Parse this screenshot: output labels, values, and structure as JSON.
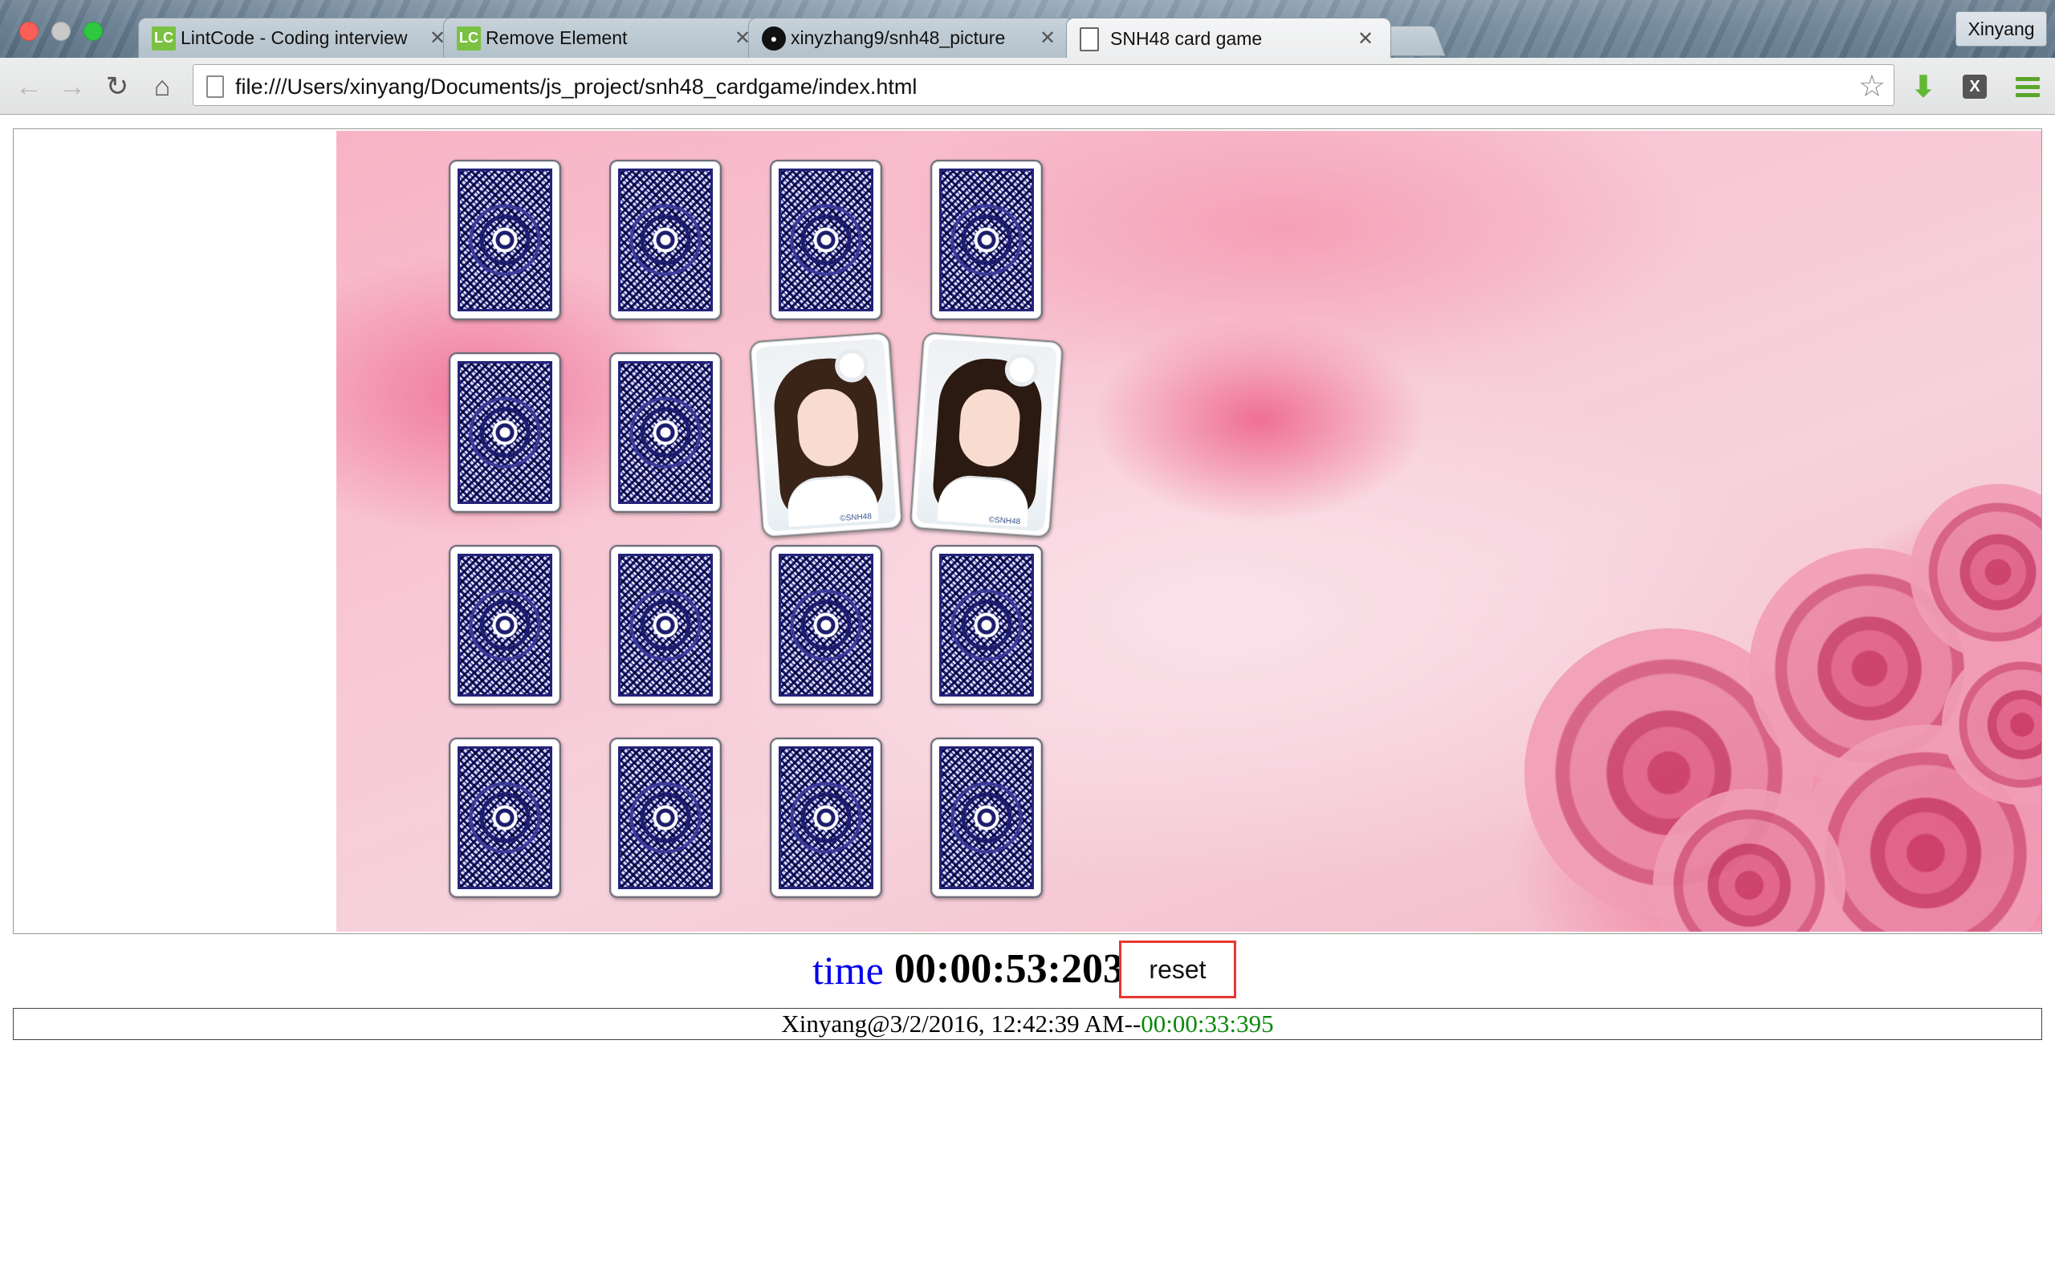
{
  "window": {
    "tabs": [
      {
        "label": "LintCode - Coding interview",
        "favicon": "LC",
        "icon": "lintcode-favicon"
      },
      {
        "label": "Remove Element",
        "favicon": "LC",
        "icon": "lintcode-favicon"
      },
      {
        "label": "xinyzhang9/snh48_picture",
        "favicon": "",
        "icon": "github-favicon"
      },
      {
        "label": "SNH48 card game",
        "favicon": "",
        "icon": "document-favicon"
      }
    ],
    "active_tab": 3,
    "profile": "Xinyang",
    "url": "file:///Users/xinyang/Documents/js_project/snh48_cardgame/index.html"
  },
  "game": {
    "cards": [
      {
        "row": 0,
        "col": 0,
        "state": "face-down"
      },
      {
        "row": 0,
        "col": 1,
        "state": "face-down"
      },
      {
        "row": 0,
        "col": 2,
        "state": "face-down"
      },
      {
        "row": 0,
        "col": 3,
        "state": "face-down"
      },
      {
        "row": 1,
        "col": 0,
        "state": "face-down"
      },
      {
        "row": 1,
        "col": 1,
        "state": "face-down"
      },
      {
        "row": 1,
        "col": 2,
        "state": "face-up"
      },
      {
        "row": 1,
        "col": 3,
        "state": "face-up"
      },
      {
        "row": 2,
        "col": 0,
        "state": "face-down"
      },
      {
        "row": 2,
        "col": 1,
        "state": "face-down"
      },
      {
        "row": 2,
        "col": 2,
        "state": "face-down"
      },
      {
        "row": 2,
        "col": 3,
        "state": "face-down"
      },
      {
        "row": 3,
        "col": 0,
        "state": "face-down"
      },
      {
        "row": 3,
        "col": 1,
        "state": "face-down"
      },
      {
        "row": 3,
        "col": 2,
        "state": "face-down"
      },
      {
        "row": 3,
        "col": 3,
        "state": "face-down"
      }
    ],
    "face_brand": "©SNH48"
  },
  "timer": {
    "label": "time",
    "value": "00:00:53:203",
    "reset_label": "reset"
  },
  "records": [
    {
      "prefix": "Xinyang@3/2/2016, 12:42:39 AM--",
      "time": "00:00:33:395"
    }
  ],
  "colors": {
    "time_label": "#0000ee",
    "record_time": "#0a8a0a",
    "reset_border": "#e8372f"
  }
}
